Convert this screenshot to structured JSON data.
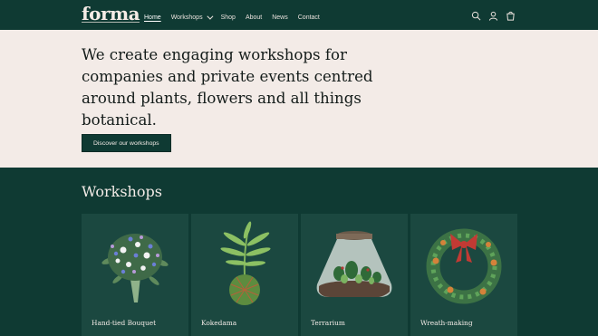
{
  "header": {
    "logo": "forma",
    "nav": [
      {
        "label": "Home",
        "active": true
      },
      {
        "label": "Workshops",
        "dropdown": true
      },
      {
        "label": "Shop"
      },
      {
        "label": "About"
      },
      {
        "label": "News"
      },
      {
        "label": "Contact"
      }
    ],
    "icons": [
      "search-icon",
      "account-icon",
      "cart-icon"
    ]
  },
  "hero": {
    "headline": "We create engaging workshops for companies and private events centred around plants, flowers and all things botanical.",
    "cta": "Discover our workshops"
  },
  "workshops": {
    "title": "Workshops",
    "cards": [
      {
        "label": "Hand-tied Bouquet",
        "image": "bouquet-illustration"
      },
      {
        "label": "Kokedama",
        "image": "kokedama-illustration"
      },
      {
        "label": "Terrarium",
        "image": "terrarium-illustration"
      },
      {
        "label": "Wreath-making",
        "image": "wreath-illustration"
      }
    ]
  },
  "colors": {
    "primary": "#0f3a33",
    "hero_bg": "#f3ebe7",
    "card_bg": "#1b4840",
    "text_light": "#f3ebe7"
  }
}
